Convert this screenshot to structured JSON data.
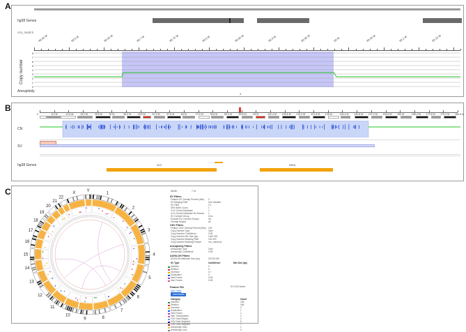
{
  "panels": {
    "a": {
      "label": "A",
      "tracks": {
        "genes": "hg38 Genes",
        "cnv": "cnv_nsab.b",
        "copy_number": "Copy number",
        "aneuploidy": "Aneuploidy"
      },
      "axis_ticks": [
        "88.65 M",
        "88.6 M",
        "88.65 M",
        "88.7 M",
        "88.75 M",
        "88.8 M",
        "88.85 M",
        "88.9 M",
        "88.95 M",
        "89 M",
        "89.05 M",
        "89.1 M",
        "89.15 M"
      ],
      "y_ticks": [
        "8",
        "7",
        "6",
        "5",
        "4",
        "3",
        "2",
        "1",
        "0"
      ],
      "aneuploidy_value": "4"
    },
    "b": {
      "label": "B",
      "coords": [
        "0",
        "6.4 M",
        "12.8 M",
        "19.2 M",
        "25.6 M",
        "32 M",
        "38.4 M",
        "44.8 M",
        "51.2 M",
        "57.6 M",
        "64 M",
        "70.4 M",
        "76.8 M",
        "83.2 M",
        "89.6 M",
        "96 M",
        "102.4 M",
        "108.8 M",
        "115.2 M",
        "121.6 M",
        "128 M",
        "134.4 M",
        "140.8 M",
        "147.2 M",
        "153.6 M",
        "160 M",
        "166.4 M",
        "172.8 M",
        "179.2 M",
        "185.6 M"
      ],
      "tracks": {
        "cn": "CN",
        "sv": "SV",
        "genes": "hg38 Genes"
      },
      "gene_labels": [
        "DCX",
        "SMN1"
      ]
    },
    "c": {
      "label": "C",
      "chromosomes": [
        "1",
        "2",
        "3",
        "4",
        "5",
        "6",
        "7",
        "8",
        "9",
        "10",
        "11",
        "12",
        "13",
        "14",
        "15",
        "16",
        "17",
        "18",
        "19",
        "20",
        "21",
        "22",
        "X",
        "Y"
      ],
      "sidebar": {
        "header_key": "ideoBr",
        "header_val": "T 44",
        "sv_filters": {
          "title": "SV Filters",
          "rows": [
            {
              "k": "Feature SV Overlap Percent (Min)",
              "v": "0"
            },
            {
              "k": "SV Merging Filter",
              "v": "Use Variable"
            },
            {
              "k": "SV Filter",
              "v": "0.1"
            },
            {
              "k": "SNV Allele Count",
              "v": "1"
            },
            {
              "k": "% in Control Database",
              "v": "1"
            },
            {
              "k": "% in Control Database No Excess",
              "v": "1"
            },
            {
              "k": "SV Consent Group",
              "v": "Zero"
            },
            {
              "k": "Exclude SV Consent Groups",
              "v": "Ice"
            },
            {
              "k": "Overlap Region",
              "v": "all"
            }
          ]
        },
        "cnv_filters": {
          "title": "CNV Filters",
          "rows": [
            {
              "k": "Feature CNV Overlap Percent (Min)",
              "v": "100"
            },
            {
              "k": "Copy Number Type",
              "v": "Gain"
            },
            {
              "k": "Copy Number Confidence",
              "v": "0.99"
            },
            {
              "k": "Copy Number Min Size (bp)",
              "v": "1000 000"
            },
            {
              "k": "Copy Number Masking Filter",
              "v": "100 000"
            },
            {
              "k": "Copy Number Masking Feature",
              "v": "cnv_mask.bw"
            }
          ]
        },
        "aneuploidy_filters": {
          "title": "Aneuploidy Filters",
          "rows": [
            {
              "k": "Aneuploidy Type",
              "v": "Gain"
            },
            {
              "k": "Aneuploidy Confidence",
              "v": "0.95"
            }
          ]
        },
        "aoh_filters": {
          "title": "AOH/LOH Filters",
          "rows": [
            {
              "k": "AOH/LOH Minimum Size (bp)",
              "v": "25 000 000"
            }
          ]
        },
        "sv_table": {
          "headers": [
            "SV Type",
            "Confidence",
            "Min Size (bp)"
          ],
          "rows": [
            {
              "type": "Insertion",
              "conf": "0",
              "color": "#2a8f3a"
            },
            {
              "type": "Deletion",
              "conf": "0",
              "color": "#d63a2a"
            },
            {
              "type": "Inversion",
              "conf": "0.7",
              "color": "#f2a900"
            },
            {
              "type": "Duplication",
              "conf": "0",
              "color": "#1f5fd6"
            },
            {
              "type": "Intra Fusion",
              "conf": "0.05",
              "color": "#b13bc9"
            },
            {
              "type": "Inter Fusion",
              "conf": "0.05",
              "color": "#e14d9a"
            }
          ]
        },
        "feature_file": {
          "title": "Feature File",
          "link": "Add Track",
          "cnv_toggle_label": "SV  CNV  Active",
          "button": "Add feature"
        },
        "category_table": {
          "headers": [
            "Category",
            "Count"
          ],
          "rows": [
            {
              "name": "Insertion",
              "count": "106",
              "color": "#2a8f3a"
            },
            {
              "name": "Deletion",
              "count": "166",
              "color": "#d63a2a"
            },
            {
              "name": "Inversion",
              "count": "3",
              "color": "#f2a900"
            },
            {
              "name": "Duplication",
              "count": "1",
              "color": "#1f5fd6"
            },
            {
              "name": "Intra Fusion",
              "count": "1",
              "color": "#b13bc9"
            },
            {
              "name": "Inter Translocation",
              "count": "2",
              "color": "#e14d9a"
            },
            {
              "name": "CNV Gain Region",
              "count": "2",
              "color": "#5aa0e6"
            },
            {
              "name": "CNV Gain Segment",
              "count": "6",
              "color": "#1a1a9e"
            },
            {
              "name": "CNV Loss Segment",
              "count": "7",
              "color": "#c21a1a"
            },
            {
              "name": "Aneuploidy Gain",
              "count": "1",
              "color": "#f5b942"
            },
            {
              "name": "Aneuploidy Loss",
              "count": "0",
              "color": "#7a7a7a"
            }
          ]
        }
      }
    }
  },
  "colors": {
    "highlight": "#b9b9f4",
    "cn_line": "#21c221",
    "gene": "#f2a20c",
    "gene_dark": "#666666",
    "chr_ring": "#f5a623"
  }
}
